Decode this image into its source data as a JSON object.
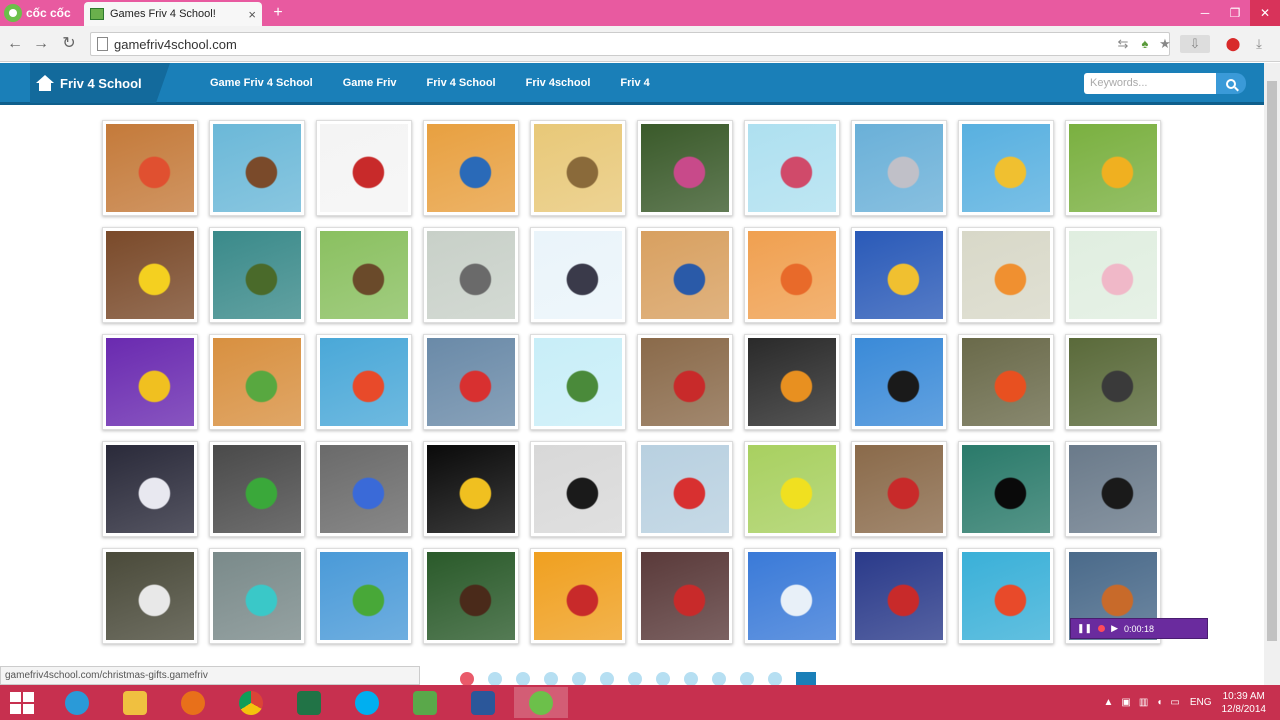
{
  "browser": {
    "brand_label": "cốc cốc",
    "tab_title": "Games Friv 4 School!",
    "url": "gamefriv4school.com"
  },
  "site": {
    "logo_text": "Friv 4 School",
    "menu": [
      "Game Friv 4 School",
      "Game Friv",
      "Friv 4 School",
      "Friv 4school",
      "Friv 4"
    ],
    "search_placeholder": "Keywords..."
  },
  "tiles": [
    [
      "#c47a3a",
      "#e05030"
    ],
    [
      "#6bb8d8",
      "#7a4a2a"
    ],
    [
      "#f4f4f4",
      "#c82a2a"
    ],
    [
      "#e8a040",
      "#2a6ab8"
    ],
    [
      "#e8c878",
      "#8a6a3a"
    ],
    [
      "#3a5a2a",
      "#c84a8a"
    ],
    [
      "#aee0f0",
      "#d04a6a"
    ],
    [
      "#6ab0d8",
      "#c0c0c8"
    ],
    [
      "#58b0e0",
      "#f0c030"
    ],
    [
      "#7ab040",
      "#f0b020"
    ],
    [
      "#7a4a2a",
      "#f4d020"
    ],
    [
      "#3a8a8a",
      "#4a6a2a"
    ],
    [
      "#8ac060",
      "#6a4a2a"
    ],
    [
      "#c8d0c8",
      "#6a6a6a"
    ],
    [
      "#eaf4fa",
      "#3a3a4a"
    ],
    [
      "#d8a060",
      "#2a5aa8"
    ],
    [
      "#f0a050",
      "#e86a2a"
    ],
    [
      "#2a5ab8",
      "#f0c030"
    ],
    [
      "#d8d8c8",
      "#f09030"
    ],
    [
      "#e0eee0",
      "#f0b8c8"
    ],
    [
      "#6a2ab0",
      "#f0c020"
    ],
    [
      "#d89040",
      "#58a840"
    ],
    [
      "#4aa8d8",
      "#e84a2a"
    ],
    [
      "#6a8aa8",
      "#d83030"
    ],
    [
      "#c8eef8",
      "#4a8a3a"
    ],
    [
      "#8a6a4a",
      "#c82a2a"
    ],
    [
      "#2a2a2a",
      "#e89020"
    ],
    [
      "#3a8ad8",
      "#1a1a1a"
    ],
    [
      "#6a6a4a",
      "#e85020"
    ],
    [
      "#5a6a3a",
      "#3a3a3a"
    ],
    [
      "#2a2a3a",
      "#e8e8f0"
    ],
    [
      "#4a4a4a",
      "#3aa83a"
    ],
    [
      "#6a6a6a",
      "#3a6ad8"
    ],
    [
      "#0a0a0a",
      "#f0c020"
    ],
    [
      "#d8d8d8",
      "#1a1a1a"
    ],
    [
      "#b8d0e0",
      "#d83030"
    ],
    [
      "#a8d060",
      "#f0e020"
    ],
    [
      "#8a6a4a",
      "#c82a2a"
    ],
    [
      "#2a7a6a",
      "#0a0a0a"
    ],
    [
      "#6a7a8a",
      "#1a1a1a"
    ],
    [
      "#4a4a3a",
      "#e8e8e8"
    ],
    [
      "#7a8a8a",
      "#3ac8c8"
    ],
    [
      "#4a9ad8",
      "#48a838"
    ],
    [
      "#2a5a2a",
      "#4a2a1a"
    ],
    [
      "#f0a020",
      "#c82a2a"
    ],
    [
      "#5a3a3a",
      "#c82a2a"
    ],
    [
      "#3a7ad8",
      "#e8f0f8"
    ],
    [
      "#2a3a8a",
      "#c82a2a"
    ],
    [
      "#3ab0d8",
      "#e84a2a"
    ],
    [
      "#4a6a8a",
      "#c86a2a"
    ]
  ],
  "pager": {
    "dots": 12,
    "active": 0
  },
  "status_url": "gamefriv4school.com/christmas-gifts.gamefriv",
  "recorder_time": "0:00:18",
  "taskbar": {
    "lang": "ENG",
    "time": "10:39 AM",
    "date": "12/8/2014"
  }
}
